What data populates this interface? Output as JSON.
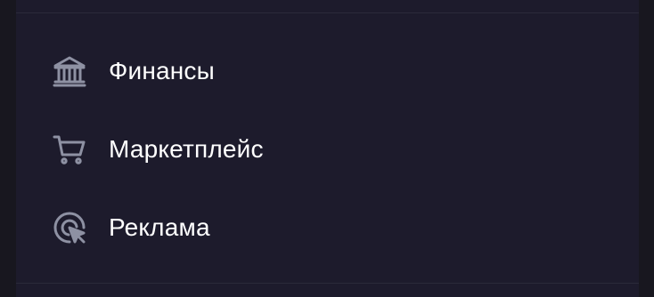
{
  "menu": {
    "items": [
      {
        "label": "Финансы",
        "icon": "bank-icon"
      },
      {
        "label": "Маркетплейс",
        "icon": "shopping-cart-icon"
      },
      {
        "label": "Реклама",
        "icon": "click-target-icon"
      }
    ]
  },
  "colors": {
    "background": "#18171f",
    "panel": "#1d1b2c",
    "divider": "#2b2a3a",
    "icon": "#8e91a3",
    "text": "#ffffff"
  }
}
